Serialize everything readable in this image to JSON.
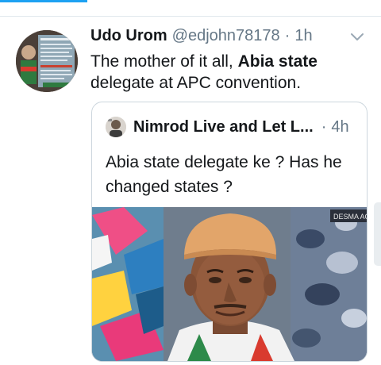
{
  "tweet": {
    "name": "Udo Urom",
    "handle": "@edjohn78178",
    "separator": "·",
    "time": "1h",
    "text_before": "The mother of it all, ",
    "text_bold": "Abia state",
    "text_after": " delegate at APC convention.",
    "menu_icon": "chevron-down-icon"
  },
  "quote": {
    "name": "Nimrod Live and Let L...",
    "separator": "·",
    "time": "4h",
    "text": "Abia state delegate ke ? Has he changed states ?",
    "photo_badge_text": "DESMA AGAI"
  },
  "colors": {
    "accent": "#1da1f2",
    "text": "#14171a",
    "secondary_text": "#657786",
    "border": "#ccd6dd"
  }
}
